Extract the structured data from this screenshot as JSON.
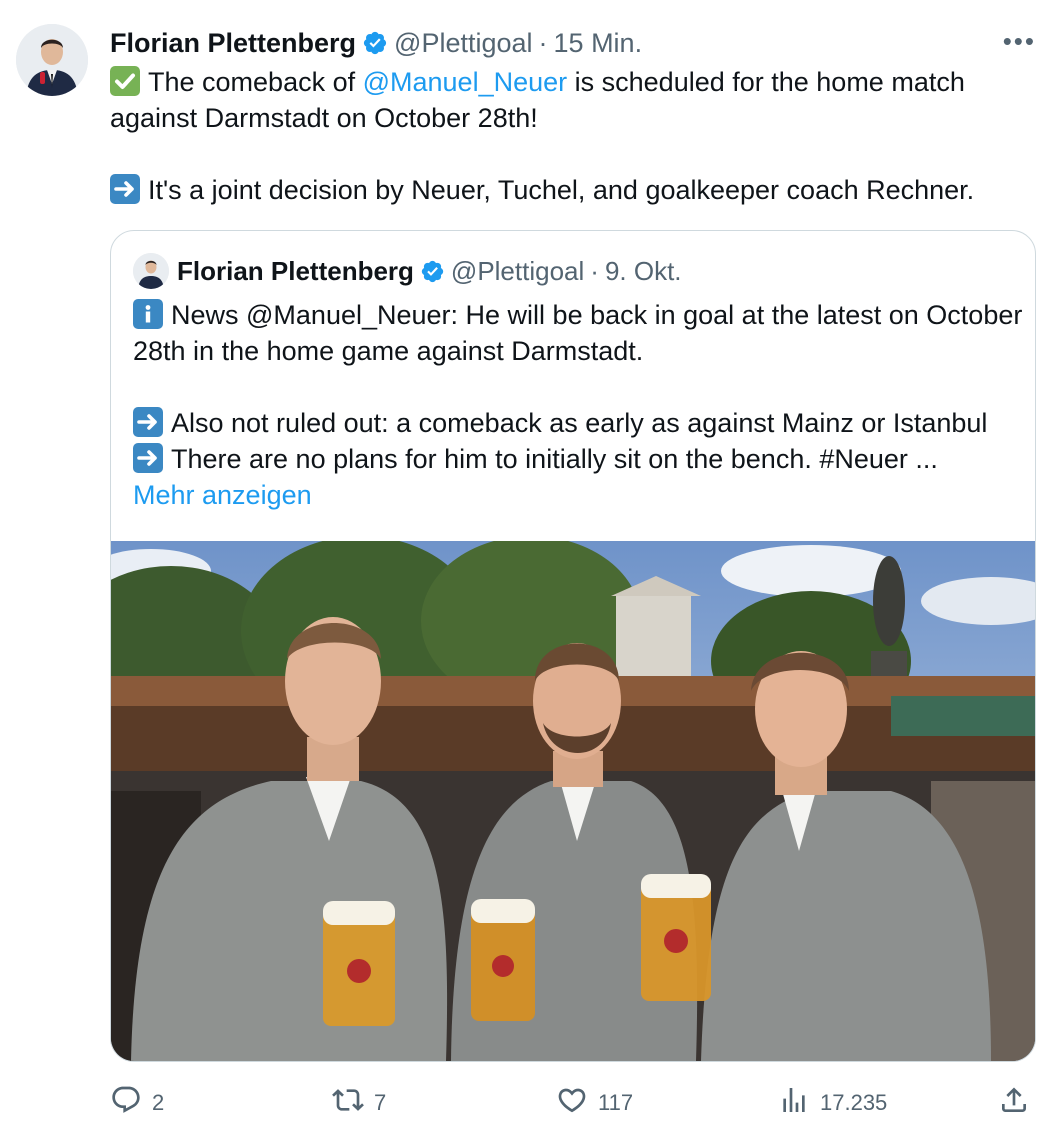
{
  "tweet": {
    "author_name": "Florian Plettenberg",
    "handle": "@Plettigoal",
    "separator": "·",
    "time": "15 Min.",
    "more_label": "•••",
    "text_line1_pre": "The comeback of ",
    "text_line1_mention": "@Manuel_Neuer",
    "text_line1_post": " is scheduled for the home match against Darmstadt on October 28th!",
    "text_line2": "It's a joint decision by Neuer, Tuchel, and goalkeeper coach Rechner."
  },
  "quote": {
    "author_name": "Florian Plettenberg",
    "handle": "@Plettigoal",
    "separator": "·",
    "date": "9. Okt.",
    "line1": "News @Manuel_Neuer: He will be back in goal at the latest on October 28th in the home game against Darmstadt.",
    "line2": "Also not ruled out: a comeback as early as against Mainz or Istanbul",
    "line3": "There are no plans for him to initially sit on the bench. #Neuer ...",
    "show_more": "Mehr anzeigen"
  },
  "actions": {
    "replies": "2",
    "retweets": "7",
    "likes": "117",
    "views": "17.235"
  },
  "colors": {
    "accent": "#1d9bf0",
    "muted": "#536471",
    "border": "#cfd9de"
  },
  "icons": [
    "verified-badge-icon",
    "check-mark-emoji",
    "german-flag-emoji",
    "right-arrow-emoji",
    "information-emoji",
    "reply-icon",
    "retweet-icon",
    "like-icon",
    "views-icon",
    "share-icon",
    "more-icon"
  ]
}
